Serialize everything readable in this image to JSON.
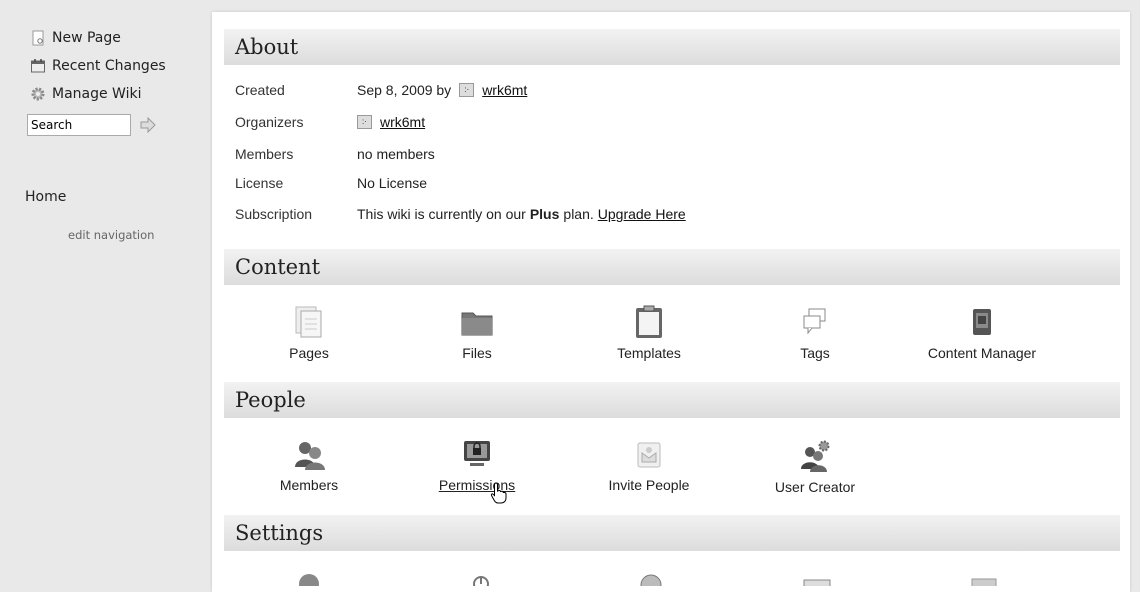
{
  "sidebar": {
    "new_page": "New Page",
    "recent_changes": "Recent Changes",
    "manage_wiki": "Manage Wiki",
    "search_value": "Search",
    "home": "Home",
    "edit_navigation": "edit navigation"
  },
  "about": {
    "title": "About",
    "rows": [
      {
        "label": "Created",
        "value_prefix": "Sep 8, 2009 by",
        "user": "wrk6mt"
      },
      {
        "label": "Organizers",
        "user": "wrk6mt"
      },
      {
        "label": "Members",
        "value": "no members"
      },
      {
        "label": "License",
        "value": "No License"
      },
      {
        "label": "Subscription",
        "value_prefix": "This wiki is currently on our",
        "plan": "Plus",
        "value_suffix": "plan.",
        "link": "Upgrade Here"
      }
    ]
  },
  "content": {
    "title": "Content",
    "items": [
      {
        "label": "Pages",
        "icon": "pages-icon"
      },
      {
        "label": "Files",
        "icon": "folder-icon"
      },
      {
        "label": "Templates",
        "icon": "clipboard-icon"
      },
      {
        "label": "Tags",
        "icon": "tags-icon"
      },
      {
        "label": "Content Manager",
        "icon": "content-manager-icon"
      }
    ]
  },
  "people": {
    "title": "People",
    "items": [
      {
        "label": "Members",
        "icon": "members-icon"
      },
      {
        "label": "Permissions",
        "icon": "permissions-icon"
      },
      {
        "label": "Invite People",
        "icon": "invite-icon"
      },
      {
        "label": "User Creator",
        "icon": "user-creator-icon"
      }
    ]
  },
  "settings": {
    "title": "Settings"
  }
}
